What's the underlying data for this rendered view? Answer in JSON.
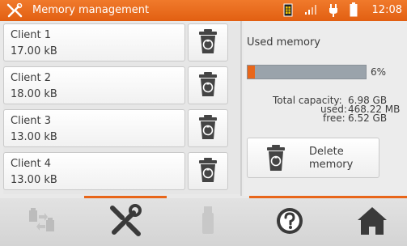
{
  "header": {
    "title": "Memory management",
    "clock": "12:08",
    "icons": [
      "tools-icon",
      "sim-card-icon",
      "signal-icon",
      "plug-icon",
      "battery-icon"
    ]
  },
  "clients": [
    {
      "name": "Client 1",
      "size": "17.00 kB"
    },
    {
      "name": "Client 2",
      "size": "18.00 kB"
    },
    {
      "name": "Client 3",
      "size": "13.00 kB"
    },
    {
      "name": "Client 4",
      "size": "13.00 kB"
    }
  ],
  "memory": {
    "used_label": "Used memory",
    "used_percent_value": 6,
    "used_percent_text": "6%",
    "total_label": "Total capacity:",
    "total_value": "6.98 GB",
    "used_key": "used:",
    "used_value": "468.22 MB",
    "free_key": "free:",
    "free_value": "6.52 GB",
    "delete_line1": "Delete",
    "delete_line2": "memory"
  },
  "bottom_nav": {
    "items": [
      "transfer-icon",
      "tools-icon",
      "usb-icon",
      "help-icon",
      "home-icon"
    ],
    "active_indicators": [
      "tools-icon",
      "home-icon"
    ]
  },
  "colors": {
    "accent": "#e8661a",
    "bar_track": "#9aa3ab"
  }
}
